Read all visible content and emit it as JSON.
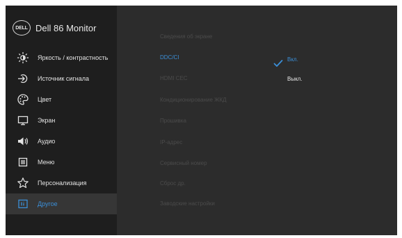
{
  "brand": {
    "logo_text": "DELL",
    "title": "Dell 86 Monitor"
  },
  "accent_color": "#3b8fd8",
  "menu": [
    {
      "label": "Яркость / контрастность",
      "icon": "brightness-icon"
    },
    {
      "label": "Источник сигнала",
      "icon": "input-source-icon"
    },
    {
      "label": "Цвет",
      "icon": "palette-icon"
    },
    {
      "label": "Экран",
      "icon": "display-icon"
    },
    {
      "label": "Аудио",
      "icon": "speaker-icon"
    },
    {
      "label": "Меню",
      "icon": "menu-icon"
    },
    {
      "label": "Персонализация",
      "icon": "star-icon"
    },
    {
      "label": "Другое",
      "icon": "info-icon",
      "active": true
    }
  ],
  "options": [
    {
      "label": "Сведения об экране"
    },
    {
      "label": "DDC/CI",
      "selected": true,
      "value": "Вкл."
    },
    {
      "label": "HDMI CEC",
      "value": "Выкл."
    },
    {
      "label": "Кондиционирование ЖКД"
    },
    {
      "label": "Прошивка"
    },
    {
      "label": "IP-адрес"
    },
    {
      "label": "Сервисный номер"
    },
    {
      "label": "Сброс др."
    },
    {
      "label": "Заводские настройки"
    }
  ]
}
